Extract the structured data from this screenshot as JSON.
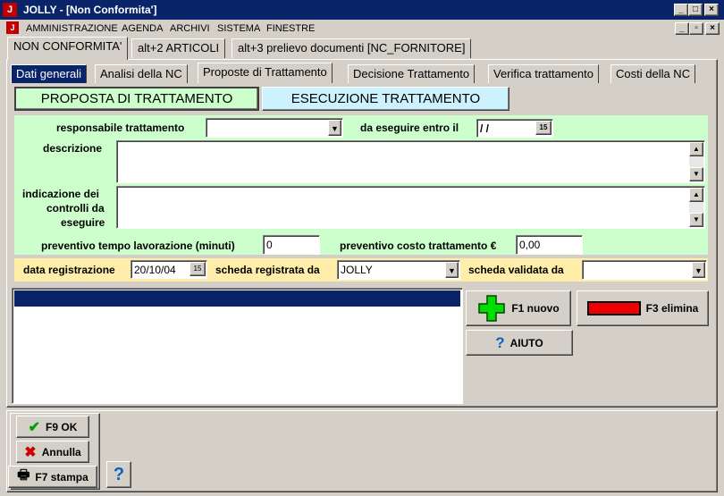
{
  "window": {
    "title": "JOLLY - [Non Conformita']",
    "icon": "J"
  },
  "menu": {
    "items": [
      "AMMINISTRAZIONE",
      "AGENDA",
      "ARCHIVI",
      "SISTEMA",
      "FINESTRE"
    ]
  },
  "main_tabs": [
    "NON CONFORMITA'",
    "alt+2  ARTICOLI",
    "alt+3  prelievo documenti [NC_FORNITORE]"
  ],
  "sub_tabs": [
    "Dati generali",
    "Analisi della NC",
    "Proposte di Trattamento",
    "Decisione Trattamento",
    "Verifica trattamento",
    "Costi della NC"
  ],
  "section_buttons": {
    "proposta": "PROPOSTA DI TRATTAMENTO",
    "esecuzione": "ESECUZIONE TRATTAMENTO"
  },
  "form": {
    "responsabile_label": "responsabile trattamento",
    "responsabile_value": "",
    "eseguire_entro_label": "da eseguire entro il",
    "eseguire_entro_value": " / /",
    "descrizione_label": "descrizione",
    "descrizione_value": "",
    "controlli_label_1": "indicazione dei",
    "controlli_label_2": "controlli da",
    "controlli_label_3": "eseguire",
    "controlli_value": "",
    "tempo_label": "preventivo tempo lavorazione (minuti)",
    "tempo_value": "0",
    "costo_label": "preventivo costo trattamento €",
    "costo_value": "0,00",
    "data_reg_label": "data registrazione",
    "data_reg_value": "20/10/04",
    "registrata_da_label": "scheda registrata da",
    "registrata_da_value": "JOLLY",
    "validata_da_label": "scheda validata da",
    "validata_da_value": ""
  },
  "actions": {
    "nuovo": "F1 nuovo",
    "elimina": "F3 elimina",
    "aiuto": "AIUTO"
  },
  "footer": {
    "ok": "F9 OK",
    "annulla": "Annulla",
    "stampa": "F7 stampa",
    "help": "?"
  },
  "colors": {
    "title_bar": "#0a246a",
    "green_panel": "#ccffcc",
    "yellow_panel": "#ffeeaa",
    "active_section": "#ccffcc",
    "inactive_section": "#ccf2ff"
  }
}
